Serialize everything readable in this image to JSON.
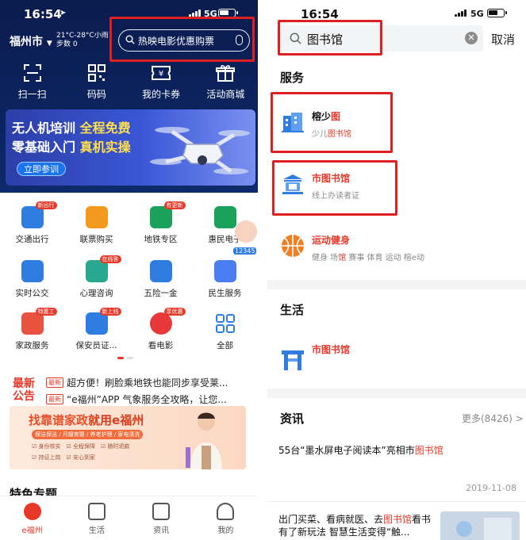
{
  "left": {
    "status": {
      "time": "16:54",
      "network": "5G"
    },
    "header": {
      "city": "福州市",
      "weather_temp": "21°C-28°C小雨",
      "steps": "步数 0",
      "search_placeholder": "热映电影优惠购票"
    },
    "quick_actions": [
      {
        "label": "扫一扫",
        "icon": "scan-icon"
      },
      {
        "label": "码码",
        "icon": "qrcode-icon"
      },
      {
        "label": "我的卡券",
        "icon": "ticket-icon"
      },
      {
        "label": "活动商城",
        "icon": "gift-icon"
      }
    ],
    "banner": {
      "line1_a": "无人机培训",
      "line1_b": " 全程免费",
      "line2_a": "零基础入门",
      "line2_b": " 真机实操",
      "button": "立即参训"
    },
    "services": [
      {
        "label": "交通出行",
        "tag": "新出行",
        "color": "#2f7de1"
      },
      {
        "label": "联票购买",
        "tag": "",
        "color": "#f39a1e"
      },
      {
        "label": "地铁专区",
        "tag": "有更新",
        "color": "#1aa15a"
      },
      {
        "label": "惠民电子",
        "tag": "",
        "color": "#1aa15a"
      },
      {
        "label": "实时公交",
        "tag": "",
        "color": "#2f7de1"
      },
      {
        "label": "心理咨询",
        "tag": "在线答",
        "color": "#2aa88f"
      },
      {
        "label": "五险一金",
        "tag": "",
        "color": "#2f7de1"
      },
      {
        "label": "民生服务",
        "tag": "",
        "color": "#4a7df0"
      },
      {
        "label": "家政服务",
        "tag": "特惠工",
        "color": "#e8523f"
      },
      {
        "label": "保安员证...",
        "tag": "新上线",
        "color": "#2f7de1"
      },
      {
        "label": "看电影",
        "tag": "享优惠",
        "color": "#e83838"
      },
      {
        "label": "全部",
        "tag": "",
        "color": "#2f7de1"
      }
    ],
    "assistant_badge": "12345",
    "news": {
      "label": "最新公告",
      "items": [
        {
          "tag": "最新",
          "text": "超方便！刷脸乘地铁也能同步享受莱..."
        },
        {
          "tag": "最新",
          "text": "“e福州”APP 气象服务全攻略，让您..."
        }
      ]
    },
    "ad": {
      "title_a": "找靠谱家政",
      "title_b": "就用e福州",
      "tags": "保洁保洁 / 月嫂育婴 / 养老护理 / 家电清洗",
      "checks": [
        "身份核实",
        "全程保障",
        "随时退款",
        "持证上岗",
        "安心到家"
      ]
    },
    "section_title": "特色专题",
    "tabs": [
      {
        "label": "e福州",
        "active": true
      },
      {
        "label": "生活",
        "active": false
      },
      {
        "label": "资讯",
        "active": false
      },
      {
        "label": "我的",
        "active": false
      }
    ]
  },
  "right": {
    "status": {
      "time": "16:54",
      "network": "5G"
    },
    "search": {
      "query": "图书馆",
      "cancel": "取消"
    },
    "services_title": "服务",
    "services": [
      {
        "title_a": "榕少",
        "title_b": "图",
        "sub_a": "少儿",
        "sub_b": "图书馆",
        "icon": "building-icon"
      },
      {
        "title_a": "",
        "title_b": "市图书馆",
        "sub_a": "线上办读者证",
        "sub_b": "",
        "icon": "library-icon"
      },
      {
        "title_a": "",
        "title_b": "运动健身",
        "sub_a": "健身 场",
        "sub_b": "馆",
        "sub_c": " 赛事 体育 运动 榕e动",
        "icon": "basketball-icon"
      }
    ],
    "life_title": "生活",
    "life_items": [
      {
        "title": "市图书馆",
        "icon": "gate-icon"
      }
    ],
    "news_title": "资讯",
    "news_more": "更多(8426) >",
    "articles": [
      {
        "a": "55台“墨水屏电子阅读本”亮相市",
        "b": "图书馆",
        "date": "2019-11-08"
      },
      {
        "a": "出门买菜、看病就医、去",
        "b": "图书馆",
        "c": "看书有了新玩法 智慧生活变得“触..."
      }
    ]
  }
}
